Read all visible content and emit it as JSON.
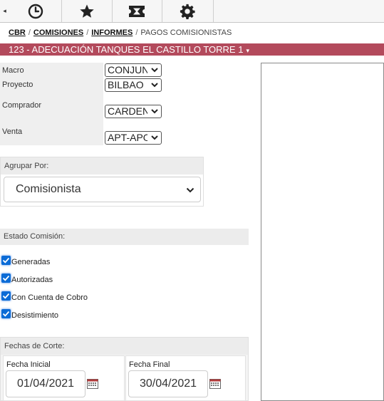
{
  "toolbar": {
    "collapse_arrow": "◂",
    "icons": [
      "clock-icon",
      "star-icon",
      "ticket-icon",
      "gear-icon"
    ]
  },
  "breadcrumb": {
    "items": [
      "CBR",
      "COMISIONES",
      "INFORMES"
    ],
    "separator": "/",
    "current": "PAGOS COMISIONISTAS"
  },
  "project": {
    "title": "123 - ADECUACIÓN TANQUES EL CASTILLO TORRE 1",
    "caret": "▾",
    "color": "#b34a5c"
  },
  "filters": {
    "macro": {
      "label": "Macro",
      "value": "CONJUNTO"
    },
    "proyecto": {
      "label": "Proyecto",
      "value": "BILBAO"
    },
    "comprador": {
      "label": "Comprador",
      "value": "CARDENAS"
    },
    "venta": {
      "label": "Venta",
      "value": "APT-APO"
    }
  },
  "agrupar": {
    "heading": "Agrupar Por:",
    "value": "Comisionista"
  },
  "estado": {
    "heading": "Estado Comisión:",
    "options": [
      {
        "label": "Generadas",
        "checked": true
      },
      {
        "label": "Autorizadas",
        "checked": true
      },
      {
        "label": "Con Cuenta de Cobro",
        "checked": true
      },
      {
        "label": "Desistimiento",
        "checked": true
      }
    ]
  },
  "fechas": {
    "heading": "Fechas de Corte:",
    "inicial": {
      "label": "Fecha Inicial",
      "value": "01/04/2021"
    },
    "final": {
      "label": "Fecha Final",
      "value": "30/04/2021"
    }
  },
  "colors": {
    "checkbox": "#0b6bd6",
    "toolbar_bg": "#f6f6f6"
  }
}
